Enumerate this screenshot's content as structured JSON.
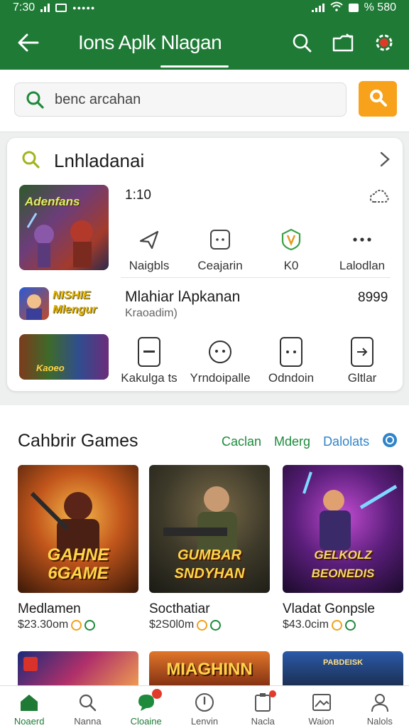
{
  "status_bar": {
    "time": "7:30",
    "carrier": "●●●●●",
    "battery_text": "% 580"
  },
  "app_bar": {
    "title": "Ions Aplk Nlagan"
  },
  "search": {
    "placeholder": "benc arcahan"
  },
  "card": {
    "header": "Lnhladanai",
    "rating": "1:10",
    "quick_actions_1": [
      {
        "icon": "share-icon",
        "label": "Naigbls"
      },
      {
        "icon": "dots-box-icon",
        "label": "Ceajarin"
      },
      {
        "icon": "badge-shield-icon",
        "label": "K0"
      },
      {
        "icon": "more-horizontal-icon",
        "label": "Lalodlan"
      }
    ],
    "app2": {
      "name": "Mlahiar lApkanan",
      "sub": "Kraoadim)",
      "price": "8999",
      "tile_text": "NISHIE\nMlengur"
    },
    "tile1_text": "Adenfans",
    "tile3_text": "Kaoeo",
    "quick_actions_2": [
      {
        "icon": "minus-box-icon",
        "label": "Kakulga ts"
      },
      {
        "icon": "face-circle-icon",
        "label": "Yrndoipalle"
      },
      {
        "icon": "dots-box-icon",
        "label": "Odndoin"
      },
      {
        "icon": "arrow-box-icon",
        "label": "Gltlar"
      }
    ]
  },
  "section": {
    "title": "Cahbrir Games",
    "links": [
      "Caclan",
      "Mderg",
      "Dalolats"
    ],
    "games": [
      {
        "name": "Medlamen",
        "price": "$23.30om",
        "art_title": "GAHNE\n6GAME"
      },
      {
        "name": "Socthatiar",
        "price": "$2S0l0m",
        "art_title": "GUMBAR\nSNDYHAN"
      },
      {
        "name": "Vladat Gonpsle",
        "price": "$43.0cim",
        "art_title": "GELKOLZ\nBEONEDIS"
      }
    ],
    "peek_titles": [
      "",
      "MIAGHINN",
      "PABDEISK"
    ]
  },
  "bottom_nav": [
    {
      "icon": "home-icon",
      "label": "Noaerd"
    },
    {
      "icon": "search-icon",
      "label": "Nanna"
    },
    {
      "icon": "chat-icon",
      "label": "Cloaine"
    },
    {
      "icon": "compass-icon",
      "label": "Lenvin"
    },
    {
      "icon": "clipboard-icon",
      "label": "Nacla"
    },
    {
      "icon": "image-icon",
      "label": "Waion"
    },
    {
      "icon": "person-icon",
      "label": "Nalols"
    }
  ],
  "colors": {
    "primary": "#1f7a36",
    "accent": "#f7a21a"
  }
}
